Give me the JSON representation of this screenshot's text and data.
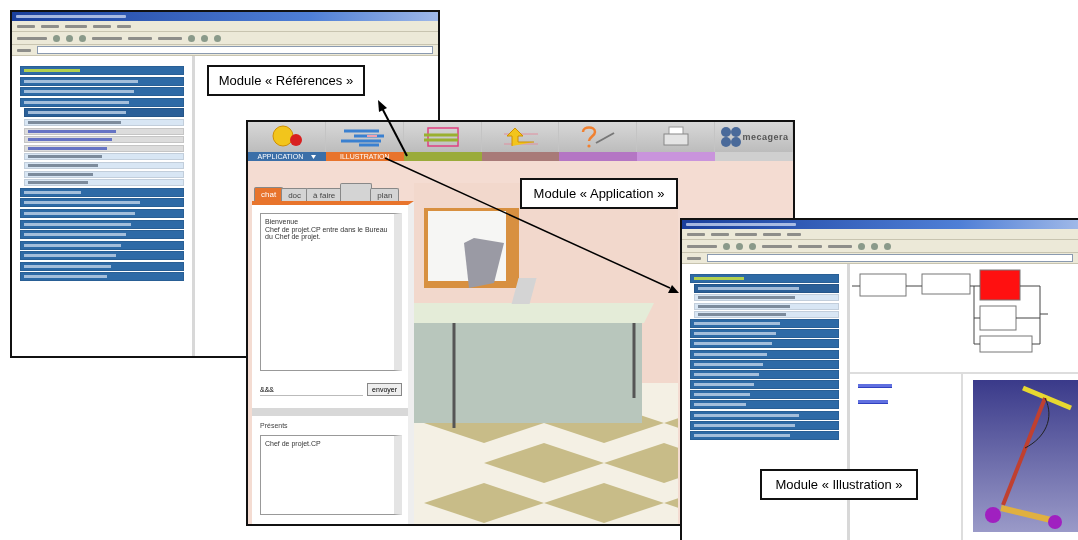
{
  "references_window": {
    "menu": [
      {
        "kind": "header"
      },
      {
        "kind": "item"
      },
      {
        "kind": "item"
      },
      {
        "kind": "item"
      },
      {
        "kind": "subheader"
      },
      {
        "kind": "entry"
      },
      {
        "kind": "link"
      },
      {
        "kind": "link"
      },
      {
        "kind": "link"
      },
      {
        "kind": "entry"
      },
      {
        "kind": "entry"
      },
      {
        "kind": "entry"
      },
      {
        "kind": "entry"
      },
      {
        "kind": "item"
      },
      {
        "kind": "item"
      },
      {
        "kind": "item"
      },
      {
        "kind": "item"
      },
      {
        "kind": "item"
      },
      {
        "kind": "item"
      },
      {
        "kind": "item"
      },
      {
        "kind": "item"
      },
      {
        "kind": "item"
      }
    ],
    "callout": "Module « Références »"
  },
  "application_window": {
    "logo": "mecagera",
    "modules": [
      {
        "label": "APPLICATION",
        "color": "#3b6fa8"
      },
      {
        "label": "ILLUSTRATION",
        "color": "#e8742c"
      },
      {
        "color": "#9aab3a"
      },
      {
        "color": "#a87a78"
      },
      {
        "color": "#b476c4"
      },
      {
        "color": "#c994dc"
      },
      {
        "color": "#cfcfcf"
      }
    ],
    "chat": {
      "tabs": [
        {
          "label": "chat",
          "selected": true
        },
        {
          "label": "doc",
          "selected": false
        },
        {
          "label": "à faire",
          "selected": false
        },
        {
          "selected": false
        },
        {
          "label": "plan",
          "selected": false
        }
      ],
      "messages": [
        "Bienvenue",
        "Chef de projet.CP entre dans le Bureau du Chef de projet."
      ],
      "input": "&&&",
      "send": "envoyer",
      "present_label": "Présents",
      "present": [
        "Chef de projet.CP"
      ]
    },
    "callout": "Module « Application »"
  },
  "illustration_window": {
    "menu": [
      {
        "kind": "header"
      },
      {
        "kind": "subheader"
      },
      {
        "kind": "entry"
      },
      {
        "kind": "entry"
      },
      {
        "kind": "entry"
      },
      {
        "kind": "item"
      },
      {
        "kind": "item"
      },
      {
        "kind": "item"
      },
      {
        "kind": "item"
      },
      {
        "kind": "item"
      },
      {
        "kind": "item"
      },
      {
        "kind": "item"
      },
      {
        "kind": "item"
      },
      {
        "kind": "item"
      },
      {
        "kind": "item"
      },
      {
        "kind": "item"
      },
      {
        "kind": "item"
      }
    ],
    "flow_nodes": [
      {
        "highlighted": false
      },
      {
        "highlighted": false
      },
      {
        "highlighted": true
      },
      {
        "highlighted": false
      },
      {
        "highlighted": false
      }
    ],
    "callout": "Module « Illustration »"
  }
}
